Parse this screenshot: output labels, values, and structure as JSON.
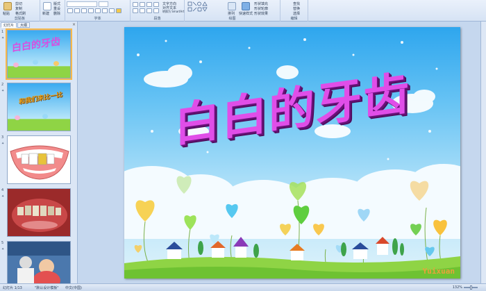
{
  "ribbon": {
    "clipboard_group": "剪贴板",
    "paste_label": "粘贴",
    "cut_label": "剪切",
    "copy_label": "复制",
    "format_painter_label": "格式刷",
    "new_slide_label": "新建\n幻灯片",
    "layout_label": "版式",
    "reset_label": "重设",
    "delete_label": "删除",
    "slides_group": "幻灯片",
    "font_group": "字体",
    "paragraph_group": "段落",
    "text_direction_label": "文字方向",
    "align_text_label": "对齐文本",
    "smartart_label": "转换为 SmartArt",
    "drawing_group": "绘图",
    "arrange_label": "排列",
    "quick_styles_label": "快速样式",
    "shape_fill_label": "形状填充",
    "shape_outline_label": "形状轮廓",
    "shape_effects_label": "形状效果",
    "editing_group": "编辑",
    "find_label": "查找",
    "replace_label": "替换",
    "select_label": "选择"
  },
  "panel": {
    "tab_slides": "幻灯片",
    "tab_outline": "大纲",
    "close_glyph": "×",
    "thumbnails": [
      {
        "num": "1",
        "text": "白白的牙齿"
      },
      {
        "num": "2",
        "text": "和我们来比一比"
      },
      {
        "num": "3",
        "text": ""
      },
      {
        "num": "4",
        "text": ""
      },
      {
        "num": "5",
        "text": ""
      }
    ]
  },
  "slide": {
    "title": "白白的牙齿",
    "watermark": "Yuixuan"
  },
  "status": {
    "slide_info": "幻灯片 1/13",
    "theme": "\"默认设计模板\"",
    "language": "中文(中国)",
    "zoom": "132%"
  },
  "colors": {
    "title": "#e04ee8",
    "title_shadow": "#6a127a",
    "sky_top": "#2ea6ee",
    "grass": "#8fd445",
    "selection": "#f6b94b"
  }
}
